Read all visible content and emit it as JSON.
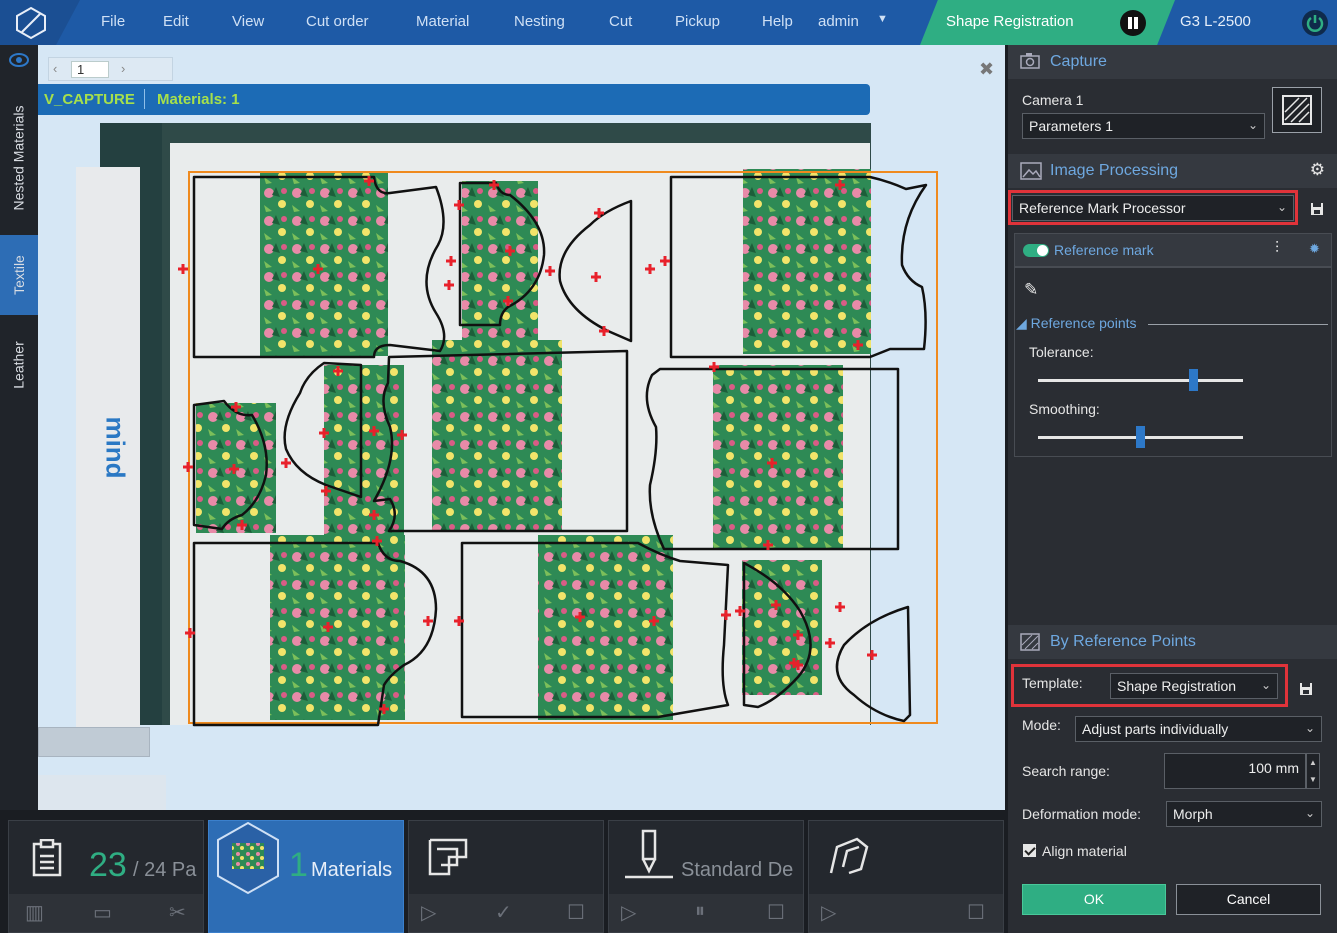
{
  "menu": {
    "items": [
      "File",
      "Edit",
      "View",
      "Cut order",
      "Material",
      "Nesting",
      "Cut",
      "Pickup",
      "Help"
    ],
    "user": "admin",
    "mode": "Shape Registration",
    "machine": "G3 L-2500"
  },
  "side_tabs": [
    "Nested Materials",
    "Textile",
    "Leather"
  ],
  "canvas": {
    "page_value": "1",
    "capture_name": "V_CAPTURE",
    "materials_label": "Materials: 1",
    "brand": "mind"
  },
  "panel": {
    "capture": {
      "title": "Capture",
      "camera_label": "Camera 1",
      "parameters_value": "Parameters 1"
    },
    "image_processing": {
      "title": "Image Processing",
      "processor_value": "Reference Mark Processor",
      "reference_mark_label": "Reference mark",
      "reference_points_label": "Reference points",
      "tolerance_label": "Tolerance:",
      "tolerance_level": 0.76,
      "smoothing_label": "Smoothing:",
      "smoothing_level": 0.5
    },
    "by_reference_points": {
      "title": "By Reference Points",
      "template_label": "Template:",
      "template_value": "Shape Registration",
      "mode_label": "Mode:",
      "mode_value": "Adjust parts individually",
      "search_range_label": "Search range:",
      "search_range_value": "100 mm",
      "deformation_label": "Deformation mode:",
      "deformation_value": "Morph",
      "align_material_label": "Align material",
      "align_material_checked": true
    },
    "ok_label": "OK",
    "cancel_label": "Cancel"
  },
  "taskbar": {
    "parts_count": "23",
    "parts_total": "/ 24 Pa",
    "materials_count": "1",
    "materials_label": "Materials",
    "standard_label": "Standard De"
  },
  "colors": {
    "accent_blue": "#1e5aa6",
    "accent_green": "#2fae83",
    "highlight_red": "#e0333a",
    "capture_text": "#a6e04b"
  }
}
